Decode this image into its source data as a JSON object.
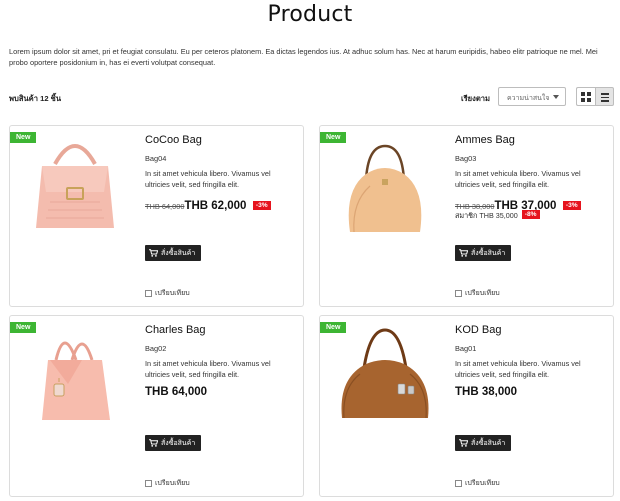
{
  "page": {
    "title": "Product",
    "intro": "Lorem ipsum dolor sit amet, pri et feugiat consulatu. Eu per ceteros platonem. Ea dictas legendos ius. At adhuc solum has. Nec at harum euripidis, habeo elitr patrioque ne mel. Mei probo oportere posidonium in, has ei everti volutpat consequat."
  },
  "toolbar": {
    "count_label": "พบสินค้า 12 ชิ้น",
    "sort_label": "เรียงตาม",
    "sort_selected": "ความน่าสนใจ",
    "grid_icon": "grid-view-icon",
    "list_icon": "list-view-icon"
  },
  "products": [
    {
      "badge": "New",
      "name": "CoCoo Bag",
      "sku": "Bag04",
      "description": "In sit amet vehicula libero. Vivamus vel ultricies velit, sed fringilla elit.",
      "price_old": "THB 64,000",
      "price_new": "THB 62,000",
      "discount": "-3%",
      "order_label": "สั่งซื้อสินค้า",
      "compare_label": "เปรียบเทียบ",
      "image_color": "#f2b3a3"
    },
    {
      "badge": "New",
      "name": "Ammes Bag",
      "sku": "Bag03",
      "description": "In sit amet vehicula libero. Vivamus vel ultricies velit, sed fringilla elit.",
      "price_old": "THB 38,000",
      "price_new": "THB 37,000",
      "discount": "-3%",
      "member_label": "สมาชิก",
      "member_price": "THB 35,000",
      "member_discount": "-8%",
      "order_label": "สั่งซื้อสินค้า",
      "compare_label": "เปรียบเทียบ",
      "image_color": "#e9b88a"
    },
    {
      "badge": "New",
      "name": "Charles Bag",
      "sku": "Bag02",
      "description": "In sit amet vehicula libero. Vivamus vel ultricies velit, sed fringilla elit.",
      "price": "THB 64,000",
      "order_label": "สั่งซื้อสินค้า",
      "compare_label": "เปรียบเทียบ",
      "image_color": "#f5b4a6"
    },
    {
      "badge": "New",
      "name": "KOD Bag",
      "sku": "Bag01",
      "description": "In sit amet vehicula libero. Vivamus vel ultricies velit, sed fringilla elit.",
      "price": "THB 38,000",
      "order_label": "สั่งซื้อสินค้า",
      "compare_label": "เปรียบเทียบ",
      "image_color": "#9a5a2e"
    }
  ]
}
